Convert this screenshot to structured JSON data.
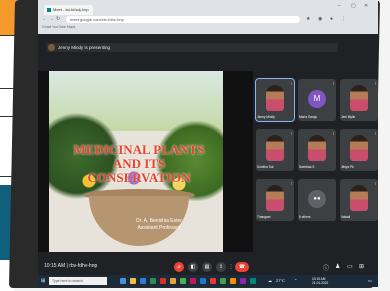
{
  "browser": {
    "tab_title": "Meet - fai-fd/sdj-hnp",
    "url": "meet.google.com/xtv-fdhv-hnp",
    "bookmarks": "Gmail   YouTube   Maps"
  },
  "meet": {
    "presenting_text": "Jenny Mindy is presenting",
    "slide": {
      "title": "MEDICINAL PLANTS AND ITS CONSERVATION",
      "author_line1": "Dr. A. Benishia Ester",
      "author_line2": "Assistant Professor",
      "caption": "Thorn bunk: Leafs leafs"
    },
    "participants": [
      {
        "name": "Jenny Mindy",
        "type": "video",
        "highlight": true
      },
      {
        "name": "Maria Sarojs",
        "type": "avatar",
        "letter": "M",
        "avatar_color": "#7e57c2"
      },
      {
        "name": "Jeni Mylin",
        "type": "video"
      },
      {
        "name": "Sunitha Sul",
        "type": "video"
      },
      {
        "name": "Swethaa S",
        "type": "video"
      },
      {
        "name": "Jibiya Pk",
        "type": "video"
      },
      {
        "name": "Thangam",
        "type": "video"
      },
      {
        "name": "5 others",
        "type": "others"
      },
      {
        "name": "Vaisali",
        "type": "video"
      }
    ],
    "time_code": "10:15 AM  |  rbv-fdhv-hnp"
  },
  "taskbar": {
    "search_placeholder": "Type here to search",
    "temp": "27°C",
    "time": "10:15 AM",
    "date": "21-01-2022"
  }
}
